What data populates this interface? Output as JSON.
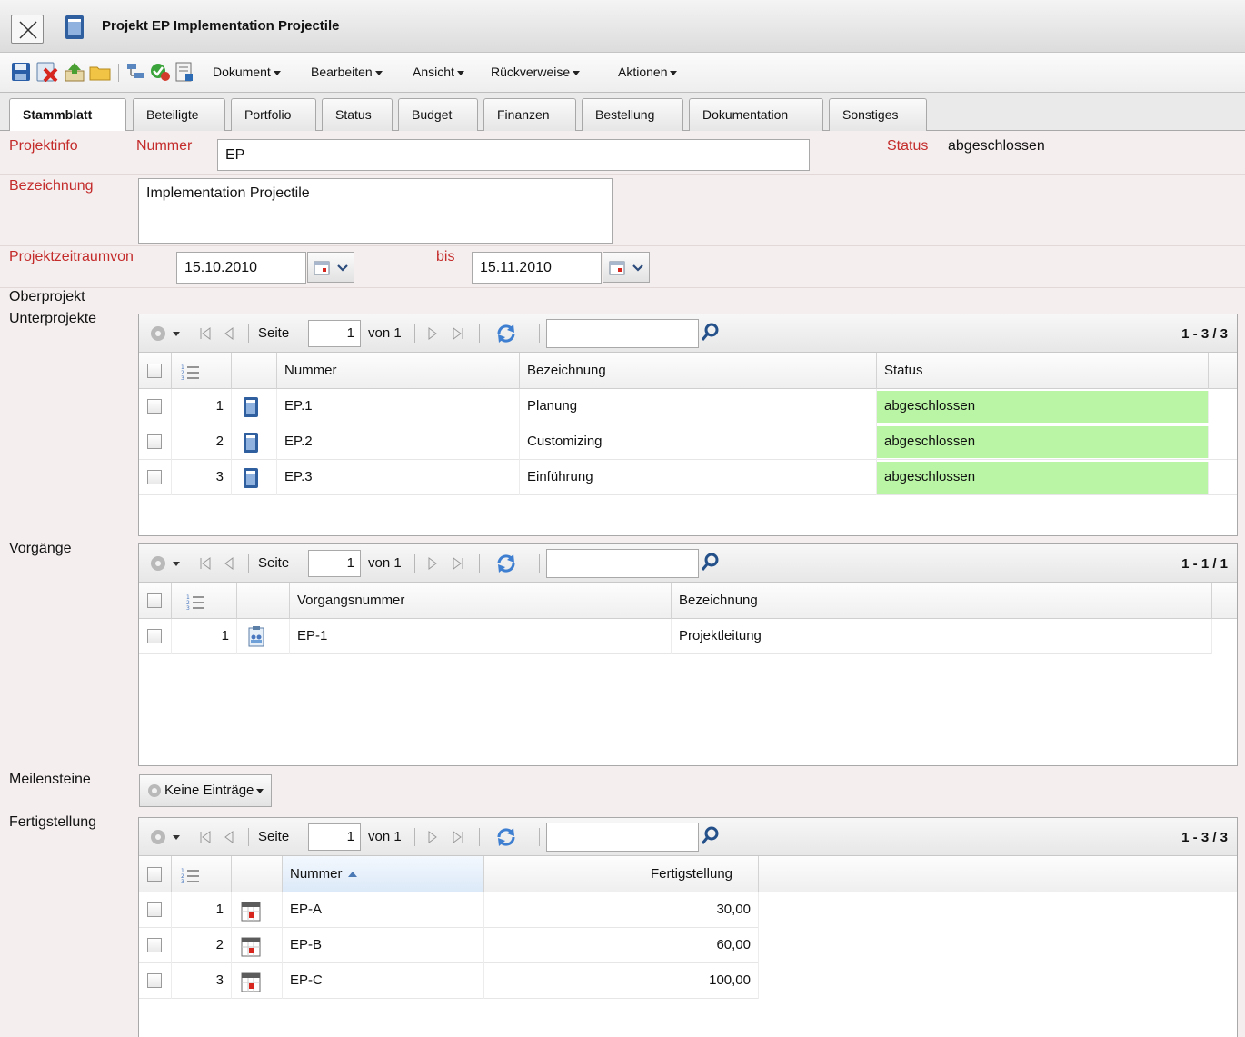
{
  "window": {
    "title": "Projekt EP Implementation Projectile"
  },
  "menus": [
    "Dokument",
    "Bearbeiten",
    "Ansicht",
    "Rückverweise",
    "Aktionen"
  ],
  "tabs": [
    {
      "label": "Stammblatt",
      "active": true
    },
    {
      "label": "Beteiligte"
    },
    {
      "label": "Portfolio"
    },
    {
      "label": "Status"
    },
    {
      "label": "Budget"
    },
    {
      "label": "Finanzen"
    },
    {
      "label": "Bestellung"
    },
    {
      "label": "Dokumentation"
    },
    {
      "label": "Sonstiges"
    }
  ],
  "form": {
    "projektinfo_label": "Projektinfo",
    "nummer_label": "Nummer",
    "nummer_value": "EP",
    "status_label": "Status",
    "status_value": "abgeschlossen",
    "bezeichnung_label": "Bezeichnung",
    "bezeichnung_value": "Implementation Projectile",
    "zeitraum_label": "Projektzeitraum",
    "von_label": "von",
    "von_value": "15.10.2010",
    "bis_label": "bis",
    "bis_value": "15.11.2010",
    "oberprojekt_label": "Oberprojekt",
    "unterprojekte_label": "Unterprojekte",
    "vorgaenge_label": "Vorgänge",
    "meilensteine_label": "Meilensteine",
    "meilensteine_button": "Keine Einträge",
    "fertigstellung_label": "Fertigstellung"
  },
  "pager": {
    "seite": "Seite",
    "page": "1",
    "von": "von 1"
  },
  "unterprojekte": {
    "count": "1 - 3 / 3",
    "columns": [
      "Nummer",
      "Bezeichnung",
      "Status"
    ],
    "rows": [
      {
        "idx": "1",
        "nummer": "EP.1",
        "bezeichnung": "Planung",
        "status": "abgeschlossen"
      },
      {
        "idx": "2",
        "nummer": "EP.2",
        "bezeichnung": "Customizing",
        "status": "abgeschlossen"
      },
      {
        "idx": "3",
        "nummer": "EP.3",
        "bezeichnung": "Einführung",
        "status": "abgeschlossen"
      }
    ]
  },
  "vorgaenge": {
    "count": "1 - 1 / 1",
    "columns": [
      "Vorgangsnummer",
      "Bezeichnung"
    ],
    "rows": [
      {
        "idx": "1",
        "nummer": "EP-1",
        "bezeichnung": "Projektleitung"
      }
    ]
  },
  "fertigstellung": {
    "count": "1 - 3 / 3",
    "columns": [
      "Nummer",
      "Fertigstellung"
    ],
    "rows": [
      {
        "idx": "1",
        "nummer": "EP-A",
        "wert": "30,00"
      },
      {
        "idx": "2",
        "nummer": "EP-B",
        "wert": "60,00"
      },
      {
        "idx": "3",
        "nummer": "EP-C",
        "wert": "100,00"
      }
    ]
  },
  "colors": {
    "label_red": "#c42b2b",
    "status_green": "#b9f5a4"
  },
  "icons": {
    "close": "close-icon",
    "document": "document-icon",
    "save": "save-icon",
    "delete": "delete-icon",
    "upload": "upload-icon",
    "folder": "folder-icon",
    "gear": "gear-icon",
    "refresh": "refresh-icon",
    "search": "search-icon",
    "calendar": "calendar-icon"
  }
}
